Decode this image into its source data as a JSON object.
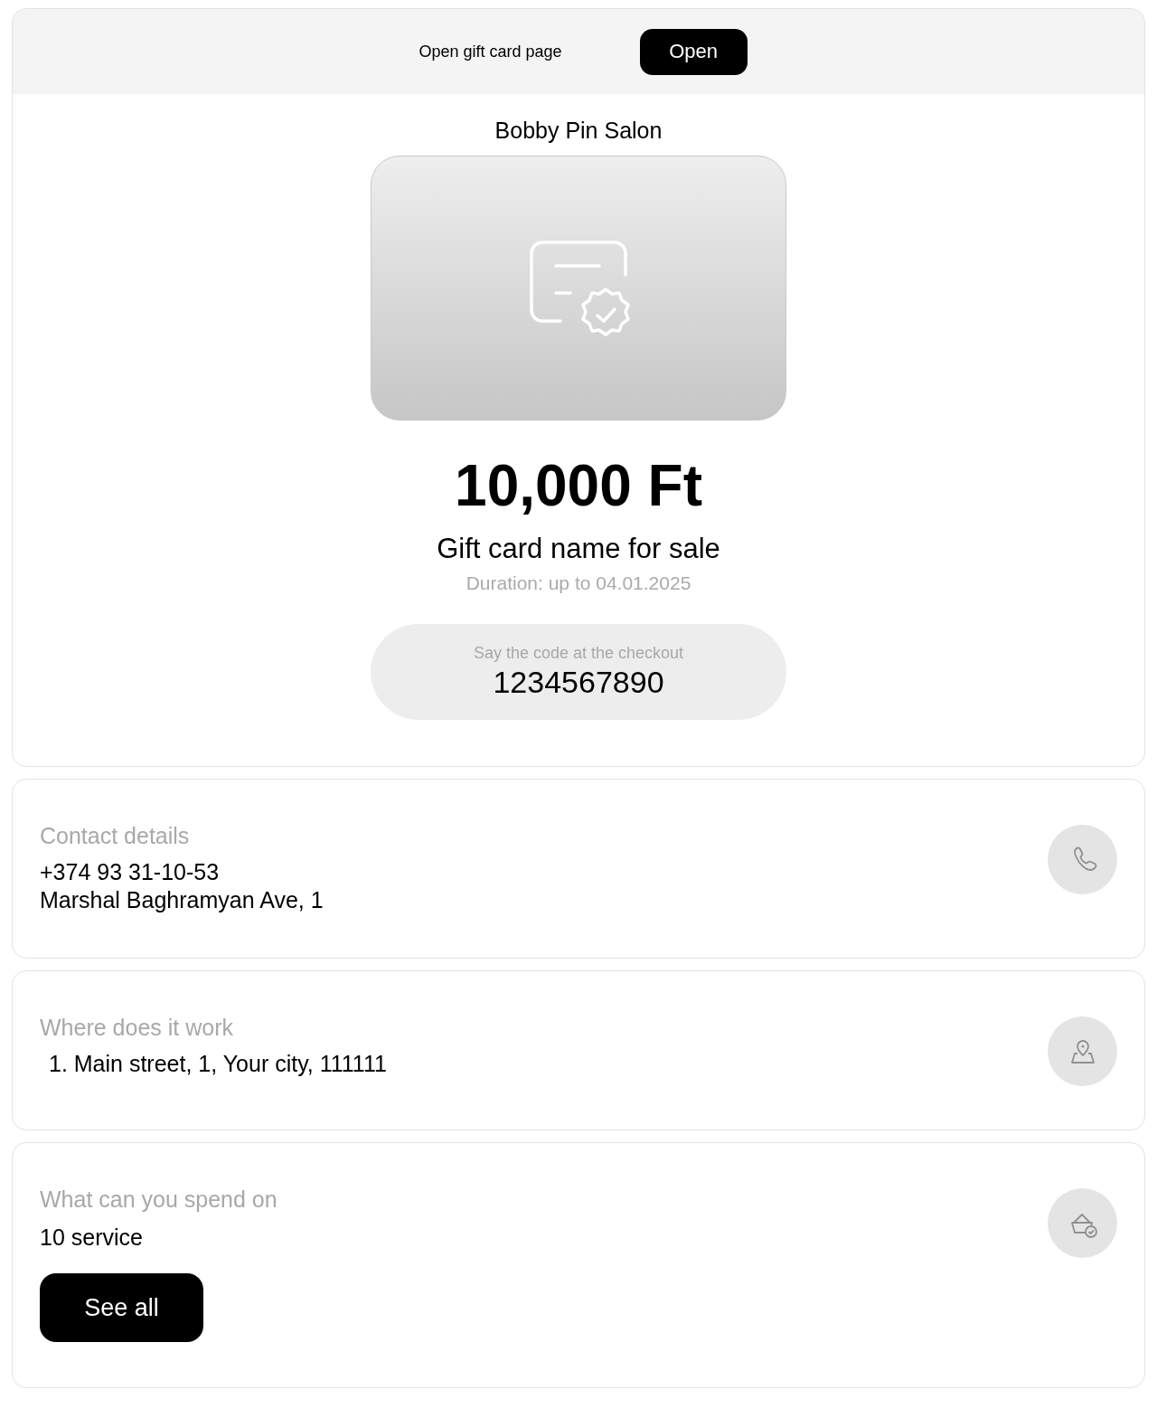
{
  "banner": {
    "text": "Open gift card page",
    "button": "Open"
  },
  "card": {
    "salon": "Bobby Pin Salon",
    "amount": "10,000 Ft",
    "name": "Gift card name for sale",
    "duration": "Duration: up to 04.01.2025",
    "code_label": "Say the code at the checkout",
    "code": "1234567890"
  },
  "sections": [
    {
      "kind": "contact",
      "title": "Contact details",
      "lines": [
        "+374 93 31-10-53",
        "Marshal Baghramyan Ave, 1"
      ]
    },
    {
      "kind": "locations",
      "title": "Where does it work",
      "lines": [
        "1. Main street, 1, Your city, 111111"
      ]
    },
    {
      "kind": "services",
      "title": "What can you spend on",
      "lines": [
        "10 service"
      ],
      "button": "See all"
    }
  ]
}
